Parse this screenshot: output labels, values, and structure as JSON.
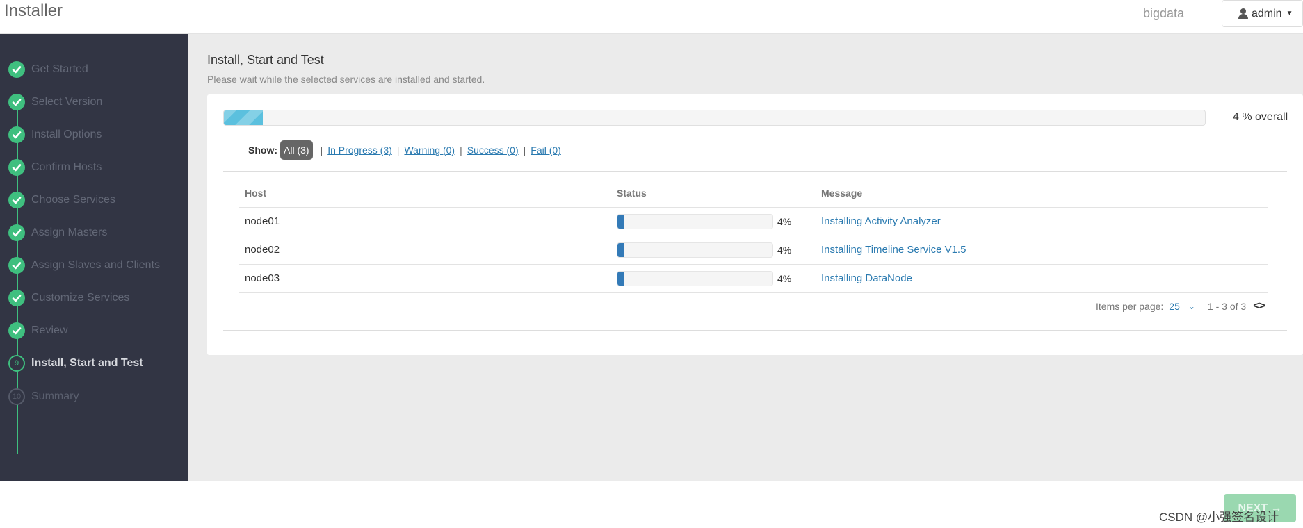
{
  "header": {
    "brand": "Installer",
    "cluster_name": "bigdata",
    "user_label": "admin"
  },
  "sidebar": {
    "steps": [
      {
        "label": "Get Started",
        "state": "done"
      },
      {
        "label": "Select Version",
        "state": "done"
      },
      {
        "label": "Install Options",
        "state": "done"
      },
      {
        "label": "Confirm Hosts",
        "state": "done"
      },
      {
        "label": "Choose Services",
        "state": "done"
      },
      {
        "label": "Assign Masters",
        "state": "done"
      },
      {
        "label": "Assign Slaves and Clients",
        "state": "done"
      },
      {
        "label": "Customize Services",
        "state": "done"
      },
      {
        "label": "Review",
        "state": "done"
      },
      {
        "label": "Install, Start and Test",
        "state": "current",
        "number": "9"
      },
      {
        "label": "Summary",
        "state": "future",
        "number": "10"
      }
    ]
  },
  "main": {
    "title": "Install, Start and Test",
    "subtitle": "Please wait while the selected services are installed and started.",
    "overall_progress": 4,
    "overall_label": "4 % overall",
    "filters": {
      "show_label": "Show:",
      "all": "All (3)",
      "in_progress": "In Progress (3)",
      "warning": "Warning (0)",
      "success": "Success (0)",
      "fail": "Fail (0)",
      "separator": "|"
    },
    "table": {
      "headers": [
        "Host",
        "Status",
        "Message"
      ],
      "rows": [
        {
          "host": "node01",
          "progress": 4,
          "pct": "4%",
          "message": "Installing Activity Analyzer"
        },
        {
          "host": "node02",
          "progress": 4,
          "pct": "4%",
          "message": "Installing Timeline Service V1.5"
        },
        {
          "host": "node03",
          "progress": 4,
          "pct": "4%",
          "message": "Installing DataNode"
        }
      ]
    },
    "pagination": {
      "items_per_page_label": "Items per page:",
      "items_per_page": "25",
      "range": "1 - 3 of 3"
    }
  },
  "footer": {
    "next_label": "NEXT →",
    "watermark": "CSDN @小强签名设计"
  },
  "colors": {
    "step_done": "#3fbf7f",
    "sidebar_bg": "#323544",
    "link": "#2a7ab0",
    "host_progress": "#337ab7",
    "overall_progress": "#5bc0de"
  }
}
